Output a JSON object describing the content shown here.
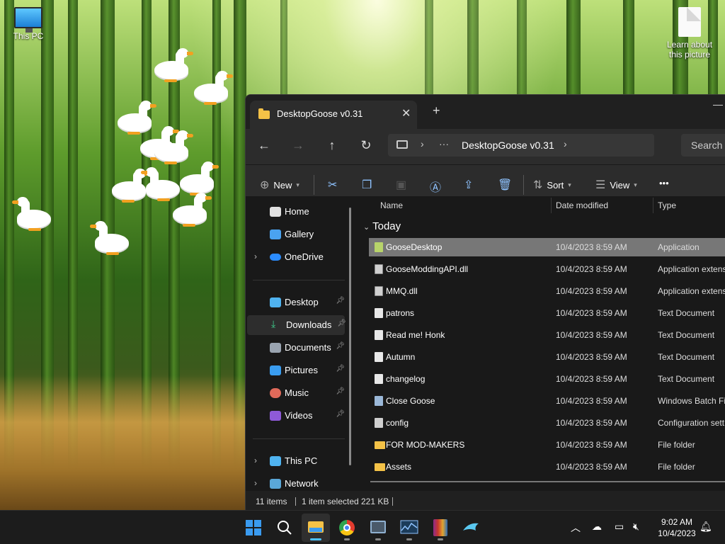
{
  "desktop": {
    "icons": [
      {
        "label": "This PC"
      },
      {
        "label": "Learn about this picture"
      }
    ]
  },
  "explorer": {
    "tab_title": "DesktopGoose v0.31",
    "new_tab": "+",
    "tab_close": "✕",
    "address_path": "DesktopGoose v0.31",
    "search_placeholder": "Search D",
    "commands": {
      "new": "New",
      "sort": "Sort",
      "view": "View",
      "more": "•••"
    },
    "nav": {
      "home": "Home",
      "gallery": "Gallery",
      "onedrive": "OneDrive",
      "desktop": "Desktop",
      "downloads": "Downloads",
      "documents": "Documents",
      "pictures": "Pictures",
      "music": "Music",
      "videos": "Videos",
      "thispc": "This PC",
      "network": "Network"
    },
    "columns": {
      "name": "Name",
      "date": "Date modified",
      "type": "Type"
    },
    "group_label": "Today",
    "files": [
      {
        "name": "GooseDesktop",
        "date": "10/4/2023 8:59 AM",
        "type": "Application"
      },
      {
        "name": "GooseModdingAPI.dll",
        "date": "10/4/2023 8:59 AM",
        "type": "Application extens"
      },
      {
        "name": "MMQ.dll",
        "date": "10/4/2023 8:59 AM",
        "type": "Application extens"
      },
      {
        "name": "patrons",
        "date": "10/4/2023 8:59 AM",
        "type": "Text Document"
      },
      {
        "name": "Read me! Honk",
        "date": "10/4/2023 8:59 AM",
        "type": "Text Document"
      },
      {
        "name": "Autumn",
        "date": "10/4/2023 8:59 AM",
        "type": "Text Document"
      },
      {
        "name": "changelog",
        "date": "10/4/2023 8:59 AM",
        "type": "Text Document"
      },
      {
        "name": "Close Goose",
        "date": "10/4/2023 8:59 AM",
        "type": "Windows Batch Fil"
      },
      {
        "name": "config",
        "date": "10/4/2023 8:59 AM",
        "type": "Configuration sett"
      },
      {
        "name": "FOR MOD-MAKERS",
        "date": "10/4/2023 8:59 AM",
        "type": "File folder"
      },
      {
        "name": "Assets",
        "date": "10/4/2023 8:59 AM",
        "type": "File folder"
      }
    ],
    "status": {
      "items": "11 items",
      "selected": "1 item selected",
      "size": "221 KB"
    }
  },
  "taskbar": {
    "time": "9:02 AM",
    "date": "10/4/2023"
  },
  "colors": {
    "accent": "#4cc2ff",
    "folder": "#f4c247",
    "selected_row": "#777777"
  }
}
